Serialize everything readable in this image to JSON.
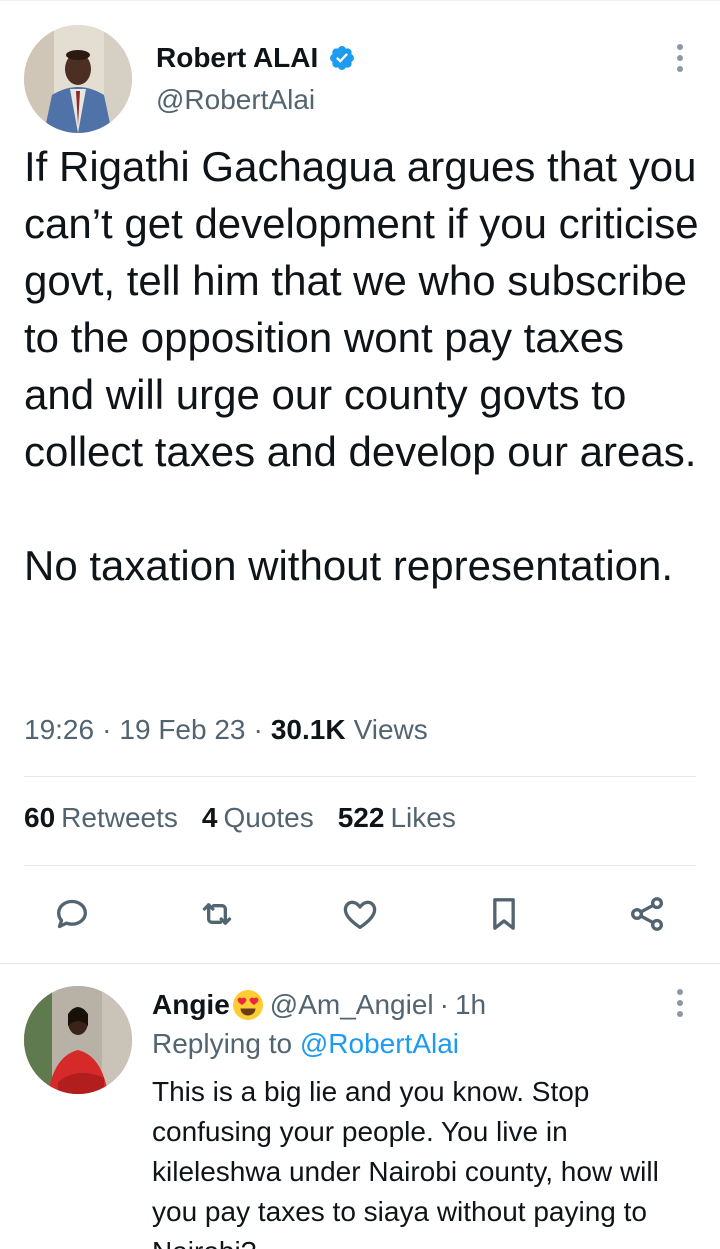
{
  "tweet": {
    "author_name": "Robert ALAI",
    "author_handle": "@RobertAlai",
    "text": "If Rigathi Gachagua argues that you can’t get development if you criticise govt, tell him that we who subscribe to the opposition wont pay taxes and will urge our county govts to collect taxes and develop our areas.\n\nNo taxation without representation.",
    "time": "19:26",
    "date": "19 Feb 23",
    "views_count": "30.1K",
    "views_label": "Views",
    "separator": "·"
  },
  "stats": {
    "retweets_count": "60",
    "retweets_label": "Retweets",
    "quotes_count": "4",
    "quotes_label": "Quotes",
    "likes_count": "522",
    "likes_label": "Likes"
  },
  "actions": [
    "reply-icon",
    "retweet-icon",
    "like-icon",
    "bookmark-icon",
    "share-icon"
  ],
  "reply": {
    "author_name": "Angie",
    "emoji": "heart-eyes-emoji",
    "author_handle": "@Am_Angiel",
    "separator": "·",
    "time": "1h",
    "replying_label": "Replying to",
    "replying_to": "@RobertAlai",
    "text": "This is a big lie and you know. Stop confusing your people. You live in kileleshwa under Nairobi county, how will you pay taxes to siaya without paying to Nairobi?"
  },
  "colors": {
    "accent": "#1d9bf0",
    "text_primary": "#0f1419",
    "text_secondary": "#536471",
    "divider": "#e6e9eb"
  }
}
